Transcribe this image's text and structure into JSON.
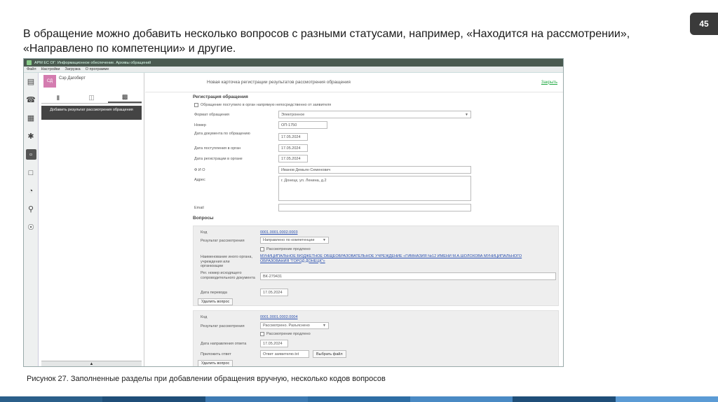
{
  "slide": {
    "heading_line1": "В обращение можно добавить несколько вопросов с разными статусами, например, «Находится на рассмотрении»,",
    "heading_line2": "«Направлено по компетенции» и другие.",
    "page_number": "45",
    "caption": "Рисунок 27. Заполненные разделы при добавлении обращения вручную, несколько кодов вопросов",
    "footer_colors": [
      "#2b5f8a",
      "#1f4e78",
      "#3d7ab3",
      "#2e6da4",
      "#4a8ac4",
      "#1f4e78",
      "#5b9bd5"
    ]
  },
  "app": {
    "window_title": "АРМ ЕС ОГ: Информационное обеспечение. Архивы обращений",
    "menu": [
      "Файл",
      "Настройки",
      "Загрузка",
      "О программе"
    ],
    "user": {
      "initials": "СД",
      "name": "Сэр Дагоберт"
    },
    "add_result_label": "Добавить результат рассмотрения обращения",
    "card_title": "Новая карточка регистрации результатов рассмотрения обращения",
    "close_link": "Закрыть",
    "registration": {
      "section_title": "Регистрация обращения",
      "checkbox_label": "Обращение поступило в орган напрямую непосредственно от заявителя",
      "format_label": "Формат обращения",
      "format_value": "Электронное",
      "number_label": "Номер",
      "number_value": "ОП-1750",
      "doc_date_label": "Дата документа по обращению",
      "doc_date_value": "17.05.2024",
      "received_label": "Дата поступления в орган",
      "received_value": "17.05.2024",
      "registered_label": "Дата регистрации в органе",
      "registered_value": "17.05.2024",
      "fio_label": "Ф И О",
      "fio_value": "Иванов Демьян Семенович",
      "address_label": "Адрес",
      "address_value": "г. Донецк, ул. Ленина, д.2",
      "email_label": "Email"
    },
    "questions": {
      "section_title": "Вопросы",
      "q1": {
        "code_label": "Код",
        "code_value": "0001.0001.0002.0003",
        "result_label": "Результат рассмотрения",
        "result_value": "Направлено по компетенции",
        "extended_label": "Рассмотрение продлено",
        "org_label": "Наименование иного органа, учреждения или организации",
        "org_value": "МУНИЦИПАЛЬНОЕ БЮДЖЕТНОЕ ОБЩЕОБРАЗОВАТЕЛЬНОЕ УЧРЕЖДЕНИЕ «ГИМНАЗИЯ №12 ИМЕНИ М.А.ШОЛОХОВА МУНИЦИПАЛЬНОГО ОБРАЗОВАНИЯ \"ГОРОД ДОНЕЦК\"»",
        "outgoing_label": "Рег. номер исходящего сопроводительного документа",
        "outgoing_value": "ВК-279431",
        "transfer_label": "Дата перевода",
        "transfer_value": "17.05.2024",
        "delete_label": "Удалить вопрос"
      },
      "q2": {
        "code_label": "Код",
        "code_value": "0001.0001.0002.0004",
        "result_label": "Результат рассмотрения",
        "result_value": "Рассмотрено. Разъяснено",
        "extended_label": "Рассмотрение продлено",
        "answer_date_label": "Дата направления ответа",
        "answer_date_value": "17.05.2024",
        "attach_label": "Приложить ответ",
        "attach_value": "Ответ заявителю.txt",
        "choose_file_label": "Выбрать файл",
        "delete_label": "Удалить вопрос"
      }
    }
  }
}
